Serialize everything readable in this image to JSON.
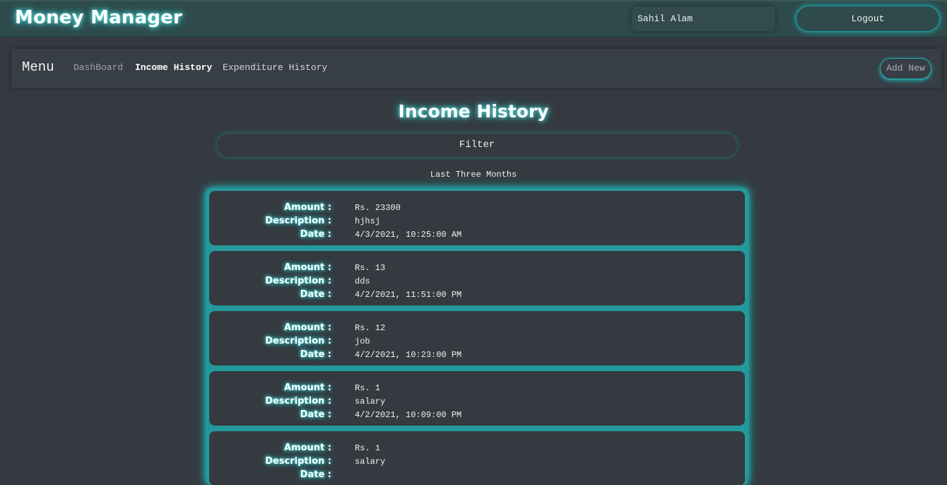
{
  "header": {
    "brand": "Money Manager",
    "user_name": "Sahil Alam",
    "logout_label": "Logout"
  },
  "nav": {
    "brand": "Menu",
    "links": [
      {
        "label": "DashBoard"
      },
      {
        "label": "Income History"
      },
      {
        "label": "Expenditure History"
      }
    ],
    "add_new_label": "Add New"
  },
  "main": {
    "title": "Income History",
    "filter_label": "Filter",
    "subtitle": "Last Three Months",
    "labels": {
      "amount": "Amount :",
      "description": "Description :",
      "date": "Date :"
    },
    "entries": [
      {
        "amount": "Rs. 23300",
        "description": "hjhsj",
        "date": "4/3/2021, 10:25:00 AM"
      },
      {
        "amount": "Rs. 13",
        "description": "dds",
        "date": "4/2/2021, 11:51:00 PM"
      },
      {
        "amount": "Rs. 12",
        "description": "job",
        "date": "4/2/2021, 10:23:00 PM"
      },
      {
        "amount": "Rs. 1",
        "description": "salary",
        "date": "4/2/2021, 10:09:00 PM"
      },
      {
        "amount": "Rs. 1",
        "description": "salary",
        "date": ""
      }
    ]
  }
}
